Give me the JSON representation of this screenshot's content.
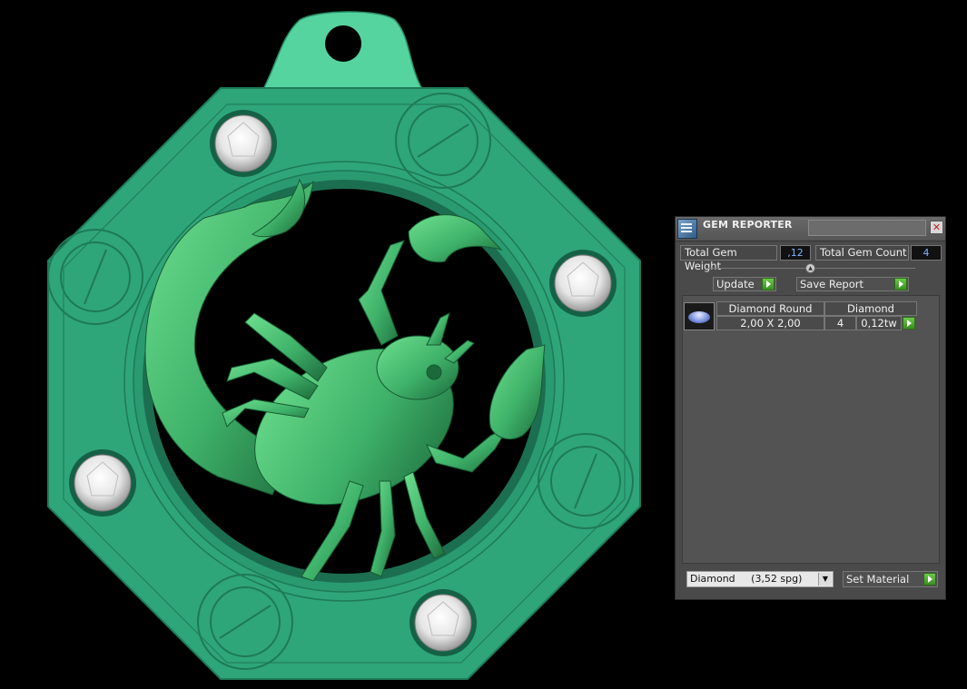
{
  "panel": {
    "title": "GEM REPORTER",
    "close_glyph": "✕",
    "icon": "gem-reporter-app-icon"
  },
  "summary": {
    "weight_label": "Total Gem Weight",
    "weight_value": ",12",
    "count_label": "Total Gem Count",
    "count_value": "4"
  },
  "actions": {
    "update_label": "Update",
    "save_report_label": "Save Report"
  },
  "table": {
    "headers": [
      "Diamond Round",
      "Diamond"
    ],
    "rows": [
      {
        "size": "2,00 X 2,00",
        "count": "4",
        "weight": "0,12tw"
      }
    ]
  },
  "material": {
    "selected": "Diamond     (3,52 spg)",
    "set_label": "Set Material"
  },
  "colors": {
    "pendant_green": "#2fa57a",
    "bail_green": "#55d4a0",
    "scorpion_green": "#3fb26a",
    "panel_bg": "#4a4a4a",
    "go_button": "#4aa832",
    "value_text": "#7fb3ff"
  }
}
